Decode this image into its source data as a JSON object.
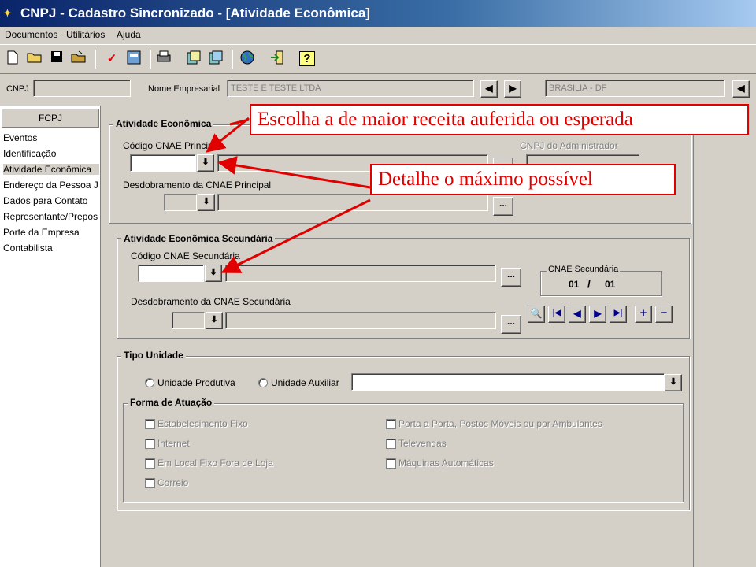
{
  "window": {
    "title": "CNPJ - Cadastro Sincronizado - [Atividade Econômica]"
  },
  "menu": [
    "Documentos",
    "Utilitários",
    "Ajuda"
  ],
  "toolbar_icons": [
    "new-document-icon",
    "open-folder-icon",
    "save-disk-icon",
    "open-file-icon",
    "check-icon",
    "form-icon",
    "printer-icon",
    "copy-icon",
    "paste-icon",
    "globe-icon",
    "exit-icon",
    "help-icon"
  ],
  "header": {
    "cnpj_label": "CNPJ",
    "cnpj_value": "",
    "nome_label": "Nome Empresarial",
    "nome_value": "TESTE E TESTE  LTDA",
    "local_value": "BRASILIA - DF"
  },
  "sidebar": {
    "header": "FCPJ",
    "items": [
      "Eventos",
      "Identificação",
      "Atividade Econômica",
      "Endereço da Pessoa J",
      "Dados para Contato",
      "Representante/Prepos",
      "Porte da Empresa",
      "Contabilista"
    ]
  },
  "atividade": {
    "title": "Atividade Econômica",
    "codigo_label": "Código CNAE Principal",
    "cnpj_admin_label": "CNPJ do Administrador",
    "desdobramento_label": "Desdobramento da CNAE Principal"
  },
  "secundaria": {
    "title": "Atividade Econômica Secundária",
    "codigo_label": "Código CNAE Secundária",
    "desdobramento_label": "Desdobramento da CNAE Secundária",
    "counter_title": "CNAE Secundária",
    "counter_current": "01",
    "counter_sep": "/",
    "counter_total": "01"
  },
  "tipo_unidade": {
    "title": "Tipo Unidade",
    "opt_produtiva": "Unidade Produtiva",
    "opt_auxiliar": "Unidade Auxiliar"
  },
  "forma_atuacao": {
    "title": "Forma de Atuação",
    "left": [
      "Estabelecimento Fixo",
      "Internet",
      "Em Local Fixo Fora de Loja",
      "Correio"
    ],
    "right": [
      "Porta a Porta, Postos Móveis ou por Ambulantes",
      "Televendas",
      "Máquinas Automáticas"
    ]
  },
  "callouts": {
    "top": "Escolha a de maior receita auferida ou esperada",
    "middle": "Detalhe o máximo possível"
  },
  "colors": {
    "callout": "#e00000",
    "titlebar": "#0a246a"
  }
}
